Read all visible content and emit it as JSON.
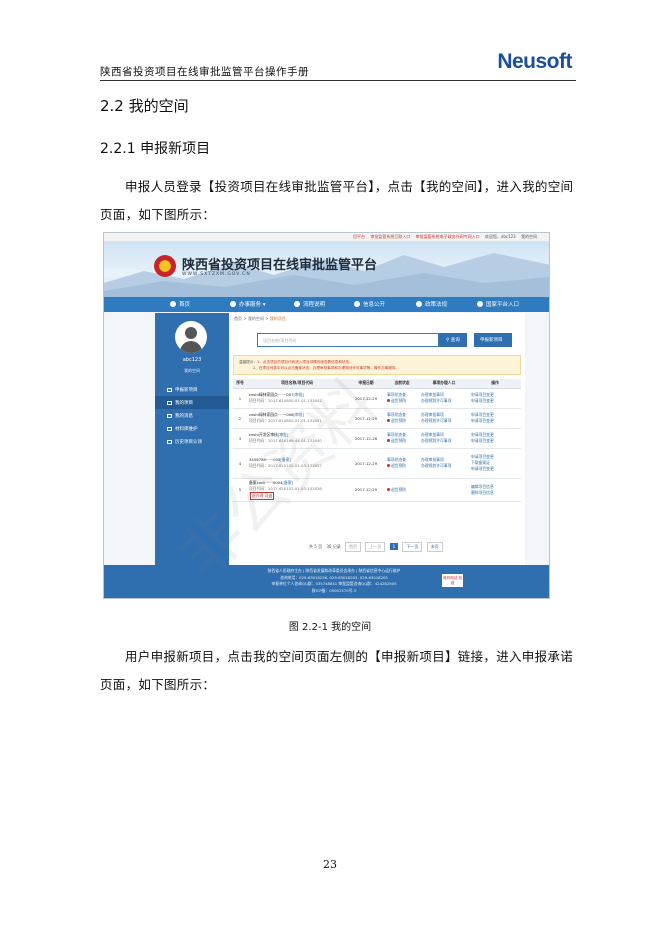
{
  "header": {
    "title": "陕西省投资项目在线审批监管平台操作手册",
    "logo": "Neusoft"
  },
  "section_title": "2.2 我的空间",
  "subsection_title": "2.2.1 申报新项目",
  "paragraph1": "申报人员登录【投资项目在线审批监管平台】，点击【我的空间】，进入我的空间页面，如下图所示：",
  "figure_caption": "图 2.2-1 我的空间",
  "paragraph2": "用户申报新项目，点击我的空间页面左侧的【申报新项目】链接，进入申报承诺页面，如下图所示：",
  "page_number": "23",
  "watermark": "非公资料",
  "screenshot": {
    "top_links": [
      "回平台",
      "审批监管系统互联入口",
      "审批监管系统电子政务外网专网入口",
      "欢迎您，abc123",
      "我的空间"
    ],
    "site_title": "陕西省投资项目在线审批监管平台",
    "site_url": "WWW.SXTZXM.GOV.CN",
    "nav": [
      "首页",
      "办事服务",
      "流程说明",
      "信息公开",
      "政策法规",
      "国家平台入口"
    ],
    "user": {
      "name": "abc123",
      "link": "我的空间"
    },
    "sidebar": [
      "申报新项目",
      "我的项目",
      "我的消息",
      "材料库维护",
      "历史项目认领"
    ],
    "breadcrumb": {
      "prefix": "首页 > 我的空间 > ",
      "current": "我的项目"
    },
    "search_placeholder": "项目名称/项目代码",
    "search_button": "查询",
    "new_button": "申报新项目",
    "tip_label": "温馨提示：",
    "tip_lines": [
      "1、点击项目的项目代码进入项目详情页面查看信息和状态。",
      "2、在项目列表中可以点击备案状态、办理审批事项和办理规划许可事项等，操作办事服务。"
    ],
    "table": {
      "headers": [
        "序号",
        "项目名称/项目代码",
        "申报日期",
        "当前状态",
        "事项办理人口",
        "操作"
      ],
      "rows": [
        {
          "no": "1",
          "name": "ceshi绿林家园点·······007",
          "tag": "[审批]",
          "code": "项目代码：2017-610800-01-01-131842",
          "date": "2017-12-29",
          "status": [
            "事项状态查",
            "退货预防"
          ],
          "entries": [
            "办理审批事项",
            "办理规划许可事项"
          ],
          "ops": [
            "申请项目变更",
            "申请项目变更"
          ]
        },
        {
          "no": "2",
          "name": "ceshi绿林家园点·······006",
          "tag": "[审批]",
          "code": "项目代码：2017-610800-01-01-131841",
          "date": "2017-12-29",
          "status": [
            "事项状态查",
            "退货预防"
          ],
          "entries": [
            "办理审批事项",
            "办理规划许可事项"
          ],
          "ops": [
            "申请项目变更",
            "申请项目变更"
          ]
        },
        {
          "no": "3",
          "name": "ceshi开发区审核",
          "tag": "[审批]",
          "code": "项目代码：2017-610169-44-01-131840",
          "date": "2017-12-26",
          "status": [
            "事项状态查",
            "退货预防"
          ],
          "entries": [
            "办理审批事项",
            "办理规划许可事项"
          ],
          "ops": [
            "申请项目变更",
            "申请项目变更"
          ]
        },
        {
          "no": "4",
          "name": "3456789······005",
          "tag": "[备案]",
          "code": "项目代码：2017-610102-01-03-131837",
          "date": "2017-12-29",
          "status": [
            "事项状态查",
            "退货预防"
          ],
          "entries": [
            "办理审批事项",
            "办理规划许可事项"
          ],
          "ops": [
            "申请项目变更",
            "下载备案证",
            "申请项目变更"
          ]
        },
        {
          "no": "5",
          "name": "备案conk······0004",
          "tag": "[备案]",
          "code": "项目代码：2017-610102-01-03-131836",
          "date": "2017-12-29",
          "status": [
            "退货预防"
          ],
          "entries": [],
          "ops": [
            "编辑项目信息",
            "删除项目信息"
          ],
          "extra": "退办理 可退"
        }
      ]
    },
    "pager": {
      "total_prefix": "共 5 页",
      "total_records": "36 记录",
      "first": "首页",
      "prev": "上一页",
      "current": "1",
      "next": "下一页",
      "last": "末页"
    },
    "footer_lines": [
      "陕西省人民政府主办  |  陕西省发展和改革委员会承办  |  陕西省信息中心运行维护",
      "咨询电话：029-63018236, 029-63018203, 029-63018205",
      "申报单位个人咨询QQ群：535748841    审批监管咨询QQ群：424282505",
      "陕ICP备：05001570号-3"
    ],
    "footer_badge": "政府网站 找错"
  }
}
